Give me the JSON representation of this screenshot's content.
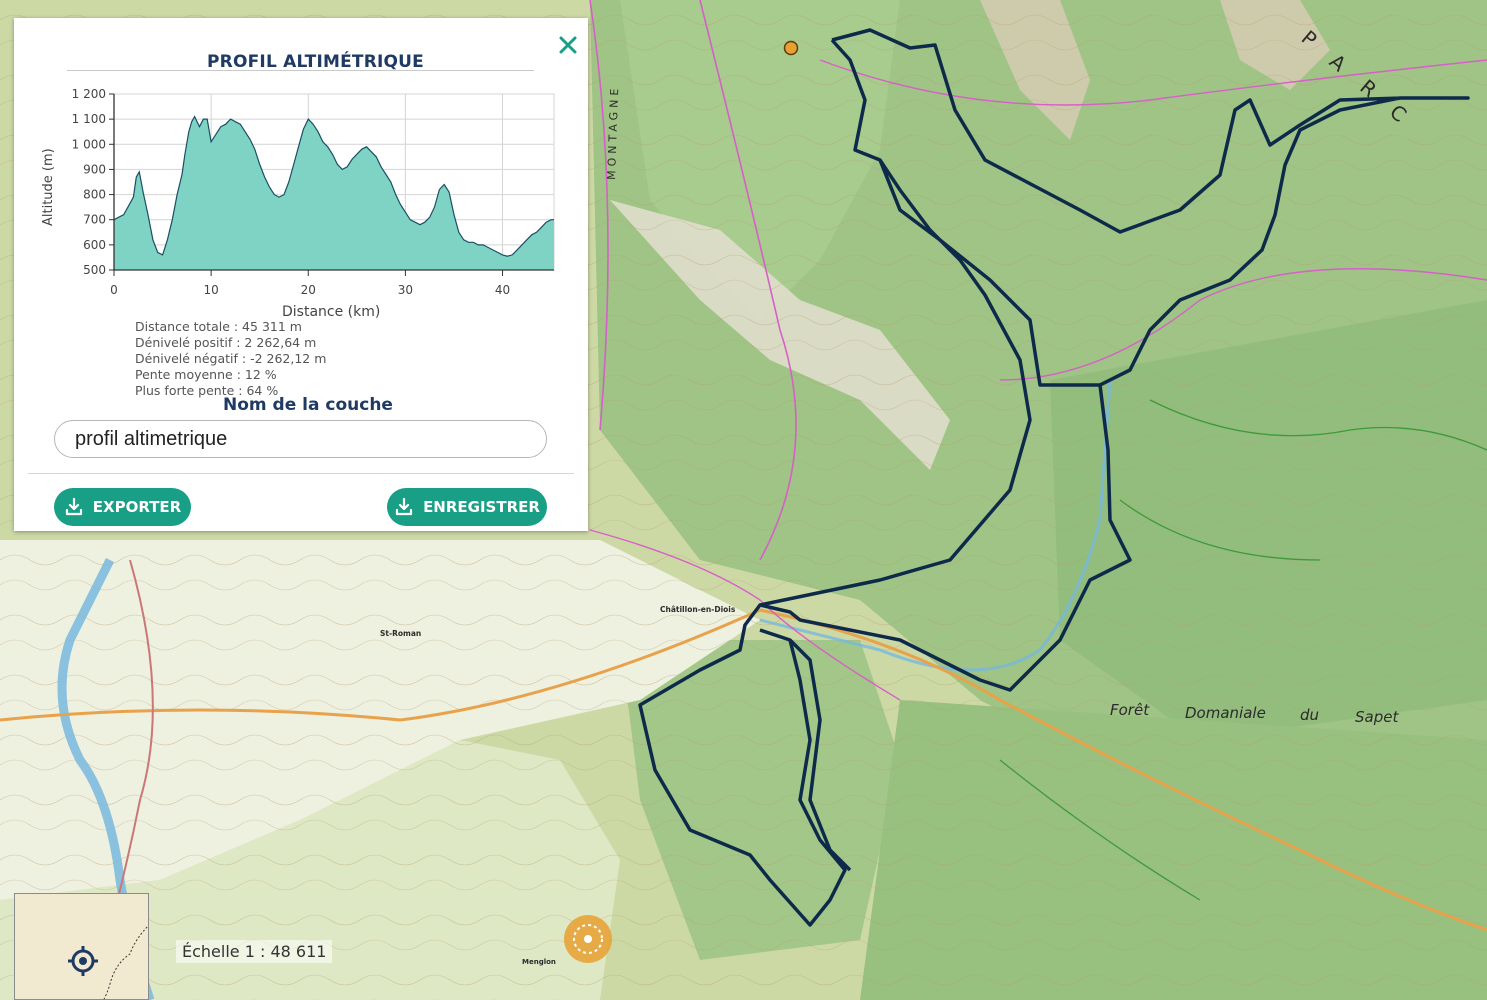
{
  "panel": {
    "title": "PROFIL ALTIMÉTRIQUE",
    "close_icon": "close-icon",
    "stats": [
      {
        "label": "Distance totale : ",
        "value": "45 311 m"
      },
      {
        "label": "Dénivelé positif : ",
        "value": "2 262,64 m"
      },
      {
        "label": "Dénivelé négatif : ",
        "value": "-2 262,12 m"
      },
      {
        "label": "Pente moyenne : ",
        "value": "12 %"
      },
      {
        "label": "Plus forte pente : ",
        "value": "64 %"
      }
    ],
    "layer_name_label": "Nom de la couche",
    "layer_name_value": "profil altimetrique",
    "export_label": "EXPORTER",
    "save_label": "ENREGISTRER",
    "button_icon": "download-icon",
    "accent_color": "#1a9f87",
    "title_color": "#1f3a63"
  },
  "chart_data": {
    "type": "area",
    "xlabel": "Distance (km)",
    "ylabel": "Altitude (m)",
    "xlim": [
      0,
      45.3
    ],
    "ylim": [
      500,
      1200
    ],
    "x_ticks": [
      0,
      10,
      20,
      30,
      40
    ],
    "y_ticks": [
      500,
      600,
      700,
      800,
      900,
      1000,
      1100,
      1200
    ],
    "y_tick_labels": [
      "500",
      "600",
      "700",
      "800",
      "900",
      "1 000",
      "1 100",
      "1 200"
    ],
    "grid": true,
    "fill_color": "#7fd3c4",
    "line_color": "#1b4e63",
    "x": [
      0,
      1,
      2,
      2.3,
      2.6,
      3,
      3.5,
      4,
      4.5,
      5,
      5.5,
      6,
      6.5,
      7,
      7.3,
      7.7,
      8,
      8.3,
      8.8,
      9.2,
      9.6,
      10,
      10.5,
      11,
      11.5,
      12,
      12.5,
      13,
      13.5,
      14,
      14.5,
      15,
      15.5,
      16,
      16.5,
      17,
      17.5,
      18,
      18.5,
      19,
      19.5,
      20,
      20.5,
      21,
      21.5,
      22,
      22.5,
      23,
      23.5,
      24,
      24.5,
      25,
      25.5,
      26,
      26.5,
      27,
      27.5,
      28,
      28.5,
      29,
      29.5,
      30,
      30.5,
      31,
      31.5,
      32,
      32.5,
      33,
      33.5,
      34,
      34.5,
      35,
      35.5,
      36,
      36.5,
      37,
      37.5,
      38,
      38.5,
      39,
      39.5,
      40,
      40.5,
      41,
      41.5,
      42,
      42.5,
      43,
      43.5,
      44,
      44.5,
      45,
      45.3
    ],
    "y": [
      700,
      720,
      790,
      870,
      890,
      810,
      720,
      620,
      570,
      560,
      620,
      700,
      800,
      880,
      960,
      1050,
      1090,
      1110,
      1070,
      1100,
      1100,
      1010,
      1040,
      1070,
      1080,
      1100,
      1090,
      1080,
      1050,
      1020,
      980,
      920,
      870,
      830,
      800,
      790,
      800,
      850,
      920,
      990,
      1060,
      1100,
      1080,
      1050,
      1010,
      990,
      960,
      920,
      900,
      910,
      940,
      960,
      980,
      990,
      970,
      950,
      910,
      880,
      850,
      800,
      760,
      730,
      700,
      690,
      680,
      690,
      710,
      750,
      820,
      840,
      810,
      720,
      650,
      620,
      610,
      610,
      600,
      600,
      590,
      580,
      570,
      560,
      555,
      560,
      580,
      600,
      620,
      640,
      650,
      670,
      690,
      700,
      700,
      690
    ]
  },
  "map": {
    "labels": {
      "montagne": "MONTAGNE",
      "parc": "PARC",
      "chatillon": "Châtillon-en-Diois",
      "st_roman": "St-Roman",
      "menglon": "Menglon",
      "foret1": "Forêt",
      "foret2": "Domaniale",
      "foret3": "du",
      "foret4": "Sapet"
    },
    "route_color": "#0e2a4a",
    "marker_icon": "location-pin-icon",
    "gps_marker_icon": "gps-position-icon"
  },
  "overview": {
    "locate_icon": "crosshair-locate-icon"
  },
  "scale": {
    "text": "Échelle 1 : 48 611"
  }
}
